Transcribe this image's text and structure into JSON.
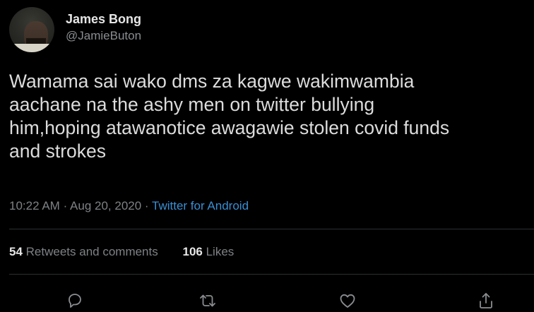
{
  "user": {
    "display_name": "James Bong",
    "handle": "@JamieButon"
  },
  "tweet": {
    "text": "Wamama sai wako dms za kagwe wakimwambia\naachane na the ashy men on twitter bullying\nhim,hoping atawanotice awagawie stolen covid funds\nand strokes",
    "time": "10:22 AM",
    "separator": "·",
    "date": "Aug 20, 2020",
    "source": "Twitter for Android"
  },
  "stats": {
    "retweets_count": "54",
    "retweets_label": "Retweets and comments",
    "likes_count": "106",
    "likes_label": "Likes"
  },
  "actions": [
    "reply-icon",
    "retweet-icon",
    "like-icon",
    "share-icon"
  ],
  "colors": {
    "background": "#000000",
    "link": "#3a8ed4",
    "muted": "#7e8185",
    "icon": "#8a8d91"
  }
}
